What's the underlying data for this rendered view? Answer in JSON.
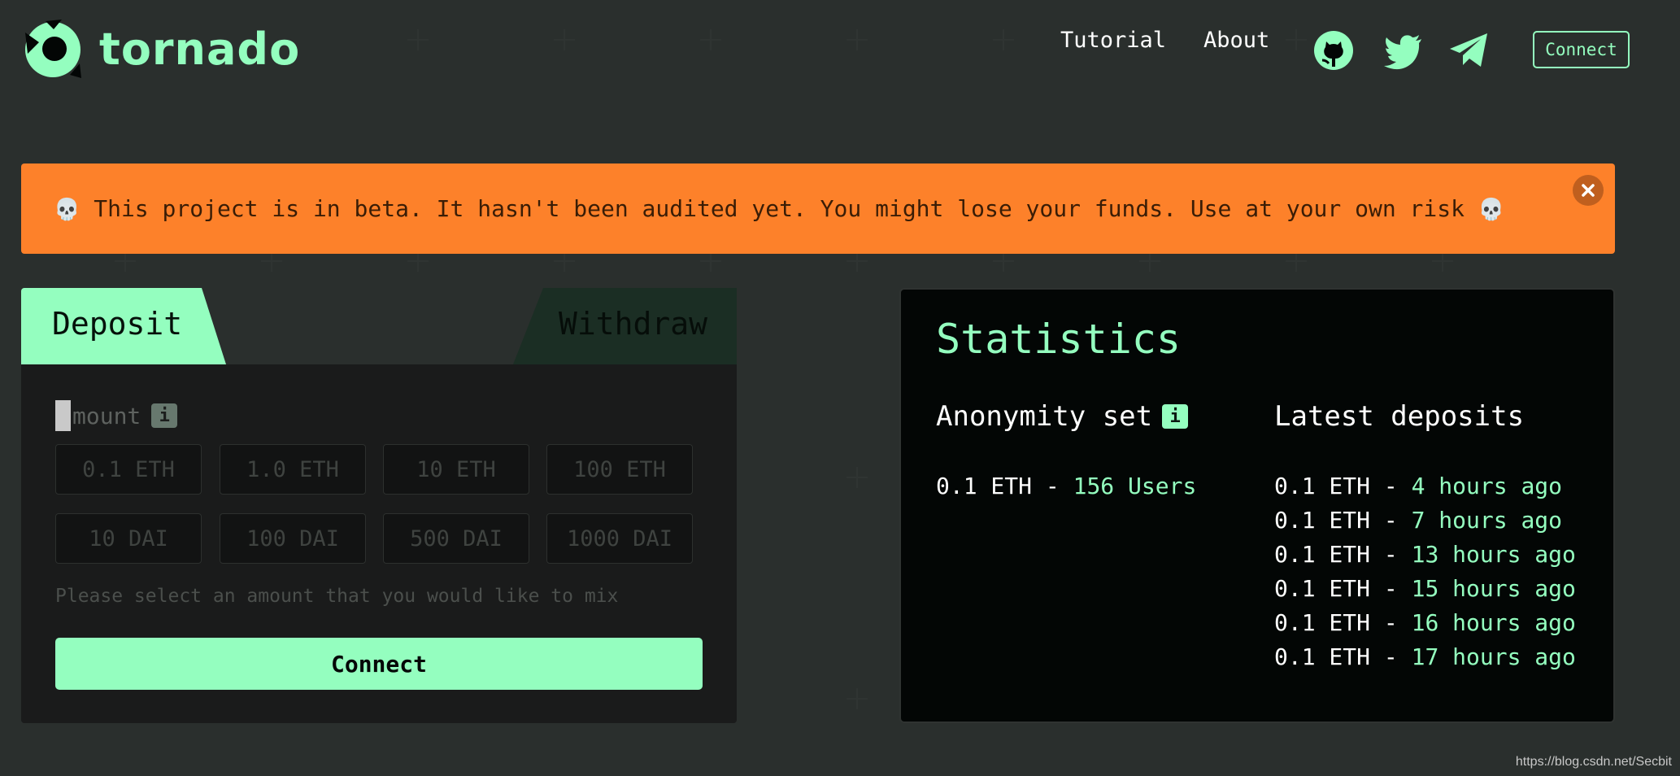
{
  "header": {
    "logo_text": "tornado",
    "nav": {
      "tutorial": "Tutorial",
      "about": "About",
      "connect": "Connect"
    },
    "icons": [
      "github-icon",
      "twitter-icon",
      "telegram-icon"
    ]
  },
  "banner": {
    "skull": "💀",
    "text": "This project is in beta. It hasn't been audited yet. You might lose your funds. Use at your own risk",
    "close_icon": "close-icon"
  },
  "deposit_card": {
    "tabs": {
      "deposit": "Deposit",
      "withdraw": "Withdraw"
    },
    "amount_label": "mount",
    "info_glyph": "i",
    "amounts": [
      [
        "0.1 ETH",
        "1.0 ETH",
        "10 ETH",
        "100 ETH"
      ],
      [
        "10 DAI",
        "100 DAI",
        "500 DAI",
        "1000 DAI"
      ]
    ],
    "hint": "Please select an amount that you would like to mix",
    "connect_label": "Connect"
  },
  "statistics": {
    "title": "Statistics",
    "anonymity_set": {
      "heading": "Anonymity set",
      "info_glyph": "i",
      "amount": "0.1 ETH",
      "separator": " - ",
      "users": "156 Users"
    },
    "latest_deposits": {
      "heading": "Latest deposits",
      "items": [
        {
          "amount": "0.1 ETH",
          "time": "4 hours ago"
        },
        {
          "amount": "0.1 ETH",
          "time": "7 hours ago"
        },
        {
          "amount": "0.1 ETH",
          "time": "13 hours ago"
        },
        {
          "amount": "0.1 ETH",
          "time": "15 hours ago"
        },
        {
          "amount": "0.1 ETH",
          "time": "16 hours ago"
        },
        {
          "amount": "0.1 ETH",
          "time": "17 hours ago"
        }
      ]
    }
  },
  "colors": {
    "accent": "#94febf",
    "background": "#030605",
    "banner": "#fd812a",
    "card": "#1a1b1b"
  },
  "watermark": "https://blog.csdn.net/Secbit"
}
